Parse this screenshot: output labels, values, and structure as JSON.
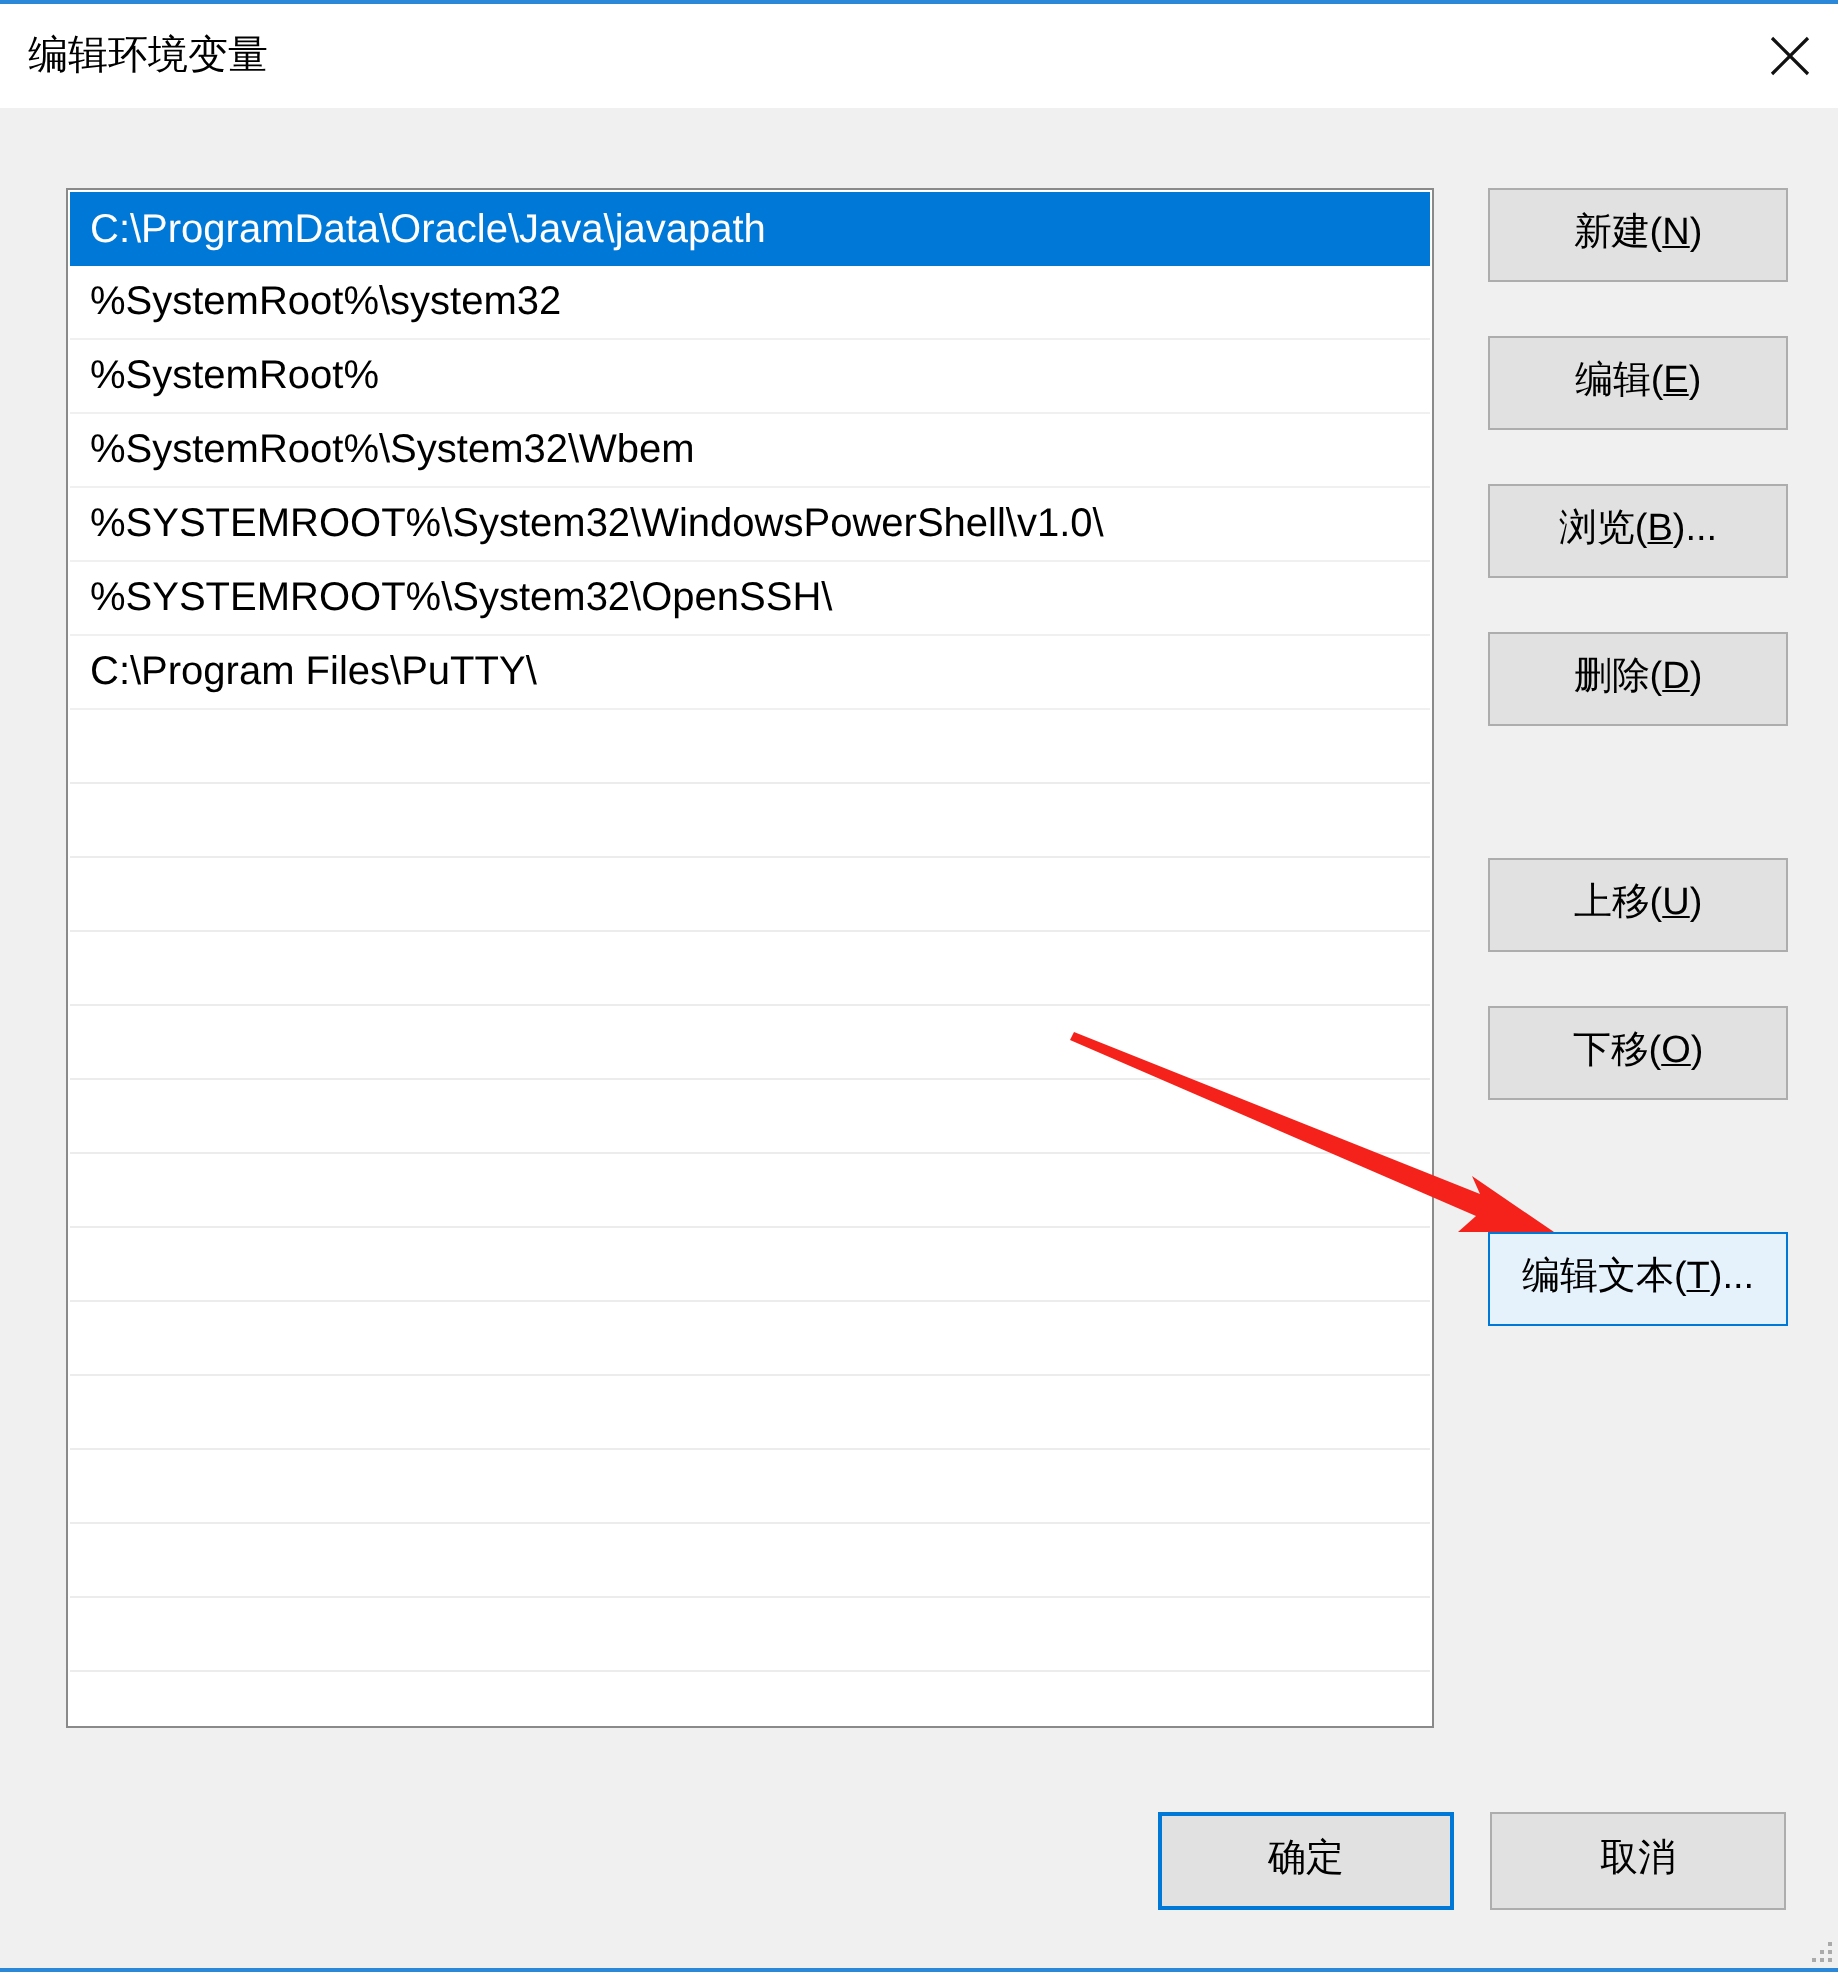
{
  "window": {
    "title": "编辑环境变量"
  },
  "paths": [
    {
      "text": "C:\\ProgramData\\Oracle\\Java\\javapath",
      "selected": true
    },
    {
      "text": "%SystemRoot%\\system32",
      "selected": false
    },
    {
      "text": "%SystemRoot%",
      "selected": false
    },
    {
      "text": "%SystemRoot%\\System32\\Wbem",
      "selected": false
    },
    {
      "text": "%SYSTEMROOT%\\System32\\WindowsPowerShell\\v1.0\\",
      "selected": false
    },
    {
      "text": "%SYSTEMROOT%\\System32\\OpenSSH\\",
      "selected": false
    },
    {
      "text": "C:\\Program Files\\PuTTY\\",
      "selected": false
    }
  ],
  "side_button_groups": [
    [
      {
        "label": "新建(N)",
        "hover": false
      },
      {
        "label": "编辑(E)",
        "hover": false
      },
      {
        "label": "浏览(B)...",
        "hover": false
      },
      {
        "label": "删除(D)",
        "hover": false
      }
    ],
    [
      {
        "label": "上移(U)",
        "hover": false
      },
      {
        "label": "下移(O)",
        "hover": false
      }
    ],
    [
      {
        "label": "编辑文本(T)...",
        "hover": true
      }
    ]
  ],
  "footer_buttons": [
    {
      "label": "确定",
      "default": true
    },
    {
      "label": "取消",
      "default": false
    }
  ]
}
